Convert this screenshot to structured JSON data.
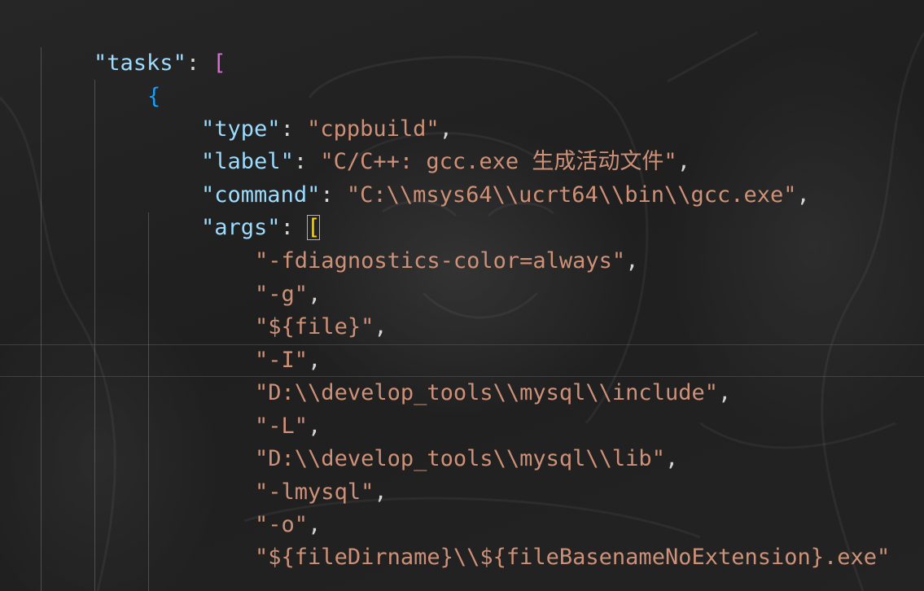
{
  "code": {
    "line1": {
      "key": "\"tasks\"",
      "colon": ": ",
      "bracket": "["
    },
    "line2": {
      "brace": "{"
    },
    "line3": {
      "key": "\"type\"",
      "colon": ": ",
      "value": "\"cppbuild\"",
      "comma": ","
    },
    "line4": {
      "key": "\"label\"",
      "colon": ": ",
      "value": "\"C/C++: gcc.exe 生成活动文件\"",
      "comma": ","
    },
    "line5": {
      "key": "\"command\"",
      "colon": ": ",
      "value": "\"C:\\\\msys64\\\\ucrt64\\\\bin\\\\gcc.exe\"",
      "comma": ","
    },
    "line6": {
      "key": "\"args\"",
      "colon": ": ",
      "bracket": "["
    },
    "args": [
      {
        "value": "\"-fdiagnostics-color=always\"",
        "comma": ","
      },
      {
        "value": "\"-g\"",
        "comma": ","
      },
      {
        "value": "\"${file}\"",
        "comma": ","
      },
      {
        "value": "\"-I\"",
        "comma": ","
      },
      {
        "value": "\"D:\\\\develop_tools\\\\mysql\\\\include\"",
        "comma": ","
      },
      {
        "value": "\"-L\"",
        "comma": ","
      },
      {
        "value": "\"D:\\\\develop_tools\\\\mysql\\\\lib\"",
        "comma": ","
      },
      {
        "value": "\"-lmysql\"",
        "comma": ","
      },
      {
        "value": "\"-o\"",
        "comma": ","
      },
      {
        "value": "\"${fileDirname}\\\\${fileBasenameNoExtension}.exe\"",
        "comma": ""
      }
    ]
  },
  "theme": {
    "background": "#1e1e1e",
    "key_color": "#9cdcfe",
    "string_color": "#ce9178",
    "bracket_level1": "#da70d6",
    "bracket_level2": "#179fff",
    "bracket_level3": "#ffd700"
  }
}
